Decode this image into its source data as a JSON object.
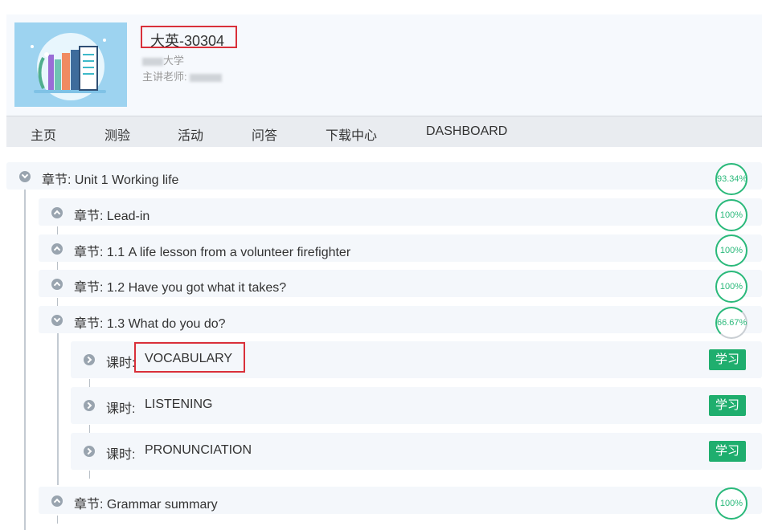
{
  "course": {
    "title": "大英-30304",
    "school_suffix": "大学",
    "teacher_label": "主讲老师:"
  },
  "nav": [
    "主页",
    "测验",
    "活动",
    "问答",
    "下载中心",
    "DASHBOARD"
  ],
  "chapters": [
    {
      "label": "章节: Unit 1 Working life",
      "progress": "93.34%"
    },
    {
      "label": "章节: Lead-in",
      "progress": "100%"
    },
    {
      "label": "章节: 1.1 A life lesson from a volunteer firefighter",
      "progress": "100%"
    },
    {
      "label": "章节: 1.2 Have you got what it takes?",
      "progress": "100%"
    },
    {
      "label": "章节: 1.3 What do you do?",
      "progress": "66.67%"
    },
    {
      "label": "章节: Grammar summary",
      "progress": "100%"
    }
  ],
  "lessons": [
    {
      "prefix": "课时:",
      "name": "VOCABULARY",
      "action": "学习"
    },
    {
      "prefix": "课时:",
      "name": "LISTENING",
      "action": "学习"
    },
    {
      "prefix": "课时:",
      "name": "PRONUNCIATION",
      "action": "学习"
    }
  ],
  "colors": {
    "accent": "#1fae6e",
    "highlight_box": "#d9303a",
    "row_bg": "#f4f7fb"
  }
}
